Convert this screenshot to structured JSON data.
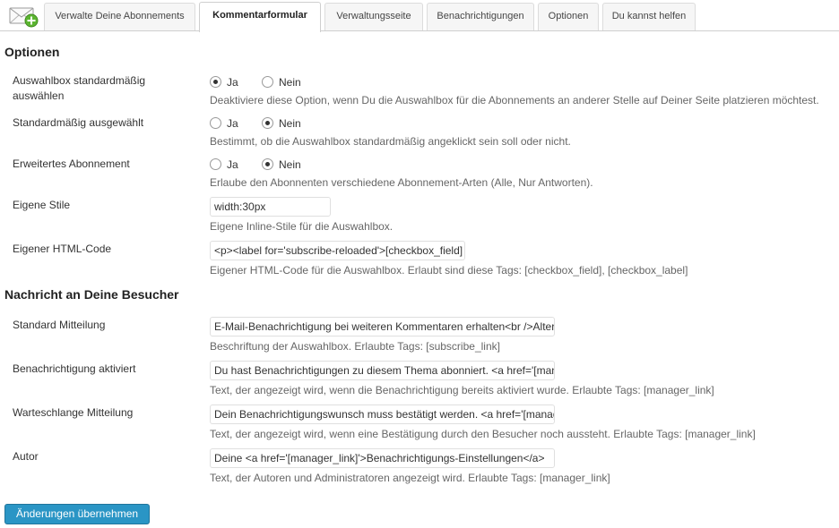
{
  "tabs": [
    {
      "label": "Verwalte Deine Abonnements",
      "active": false
    },
    {
      "label": "Kommentarformular",
      "active": true
    },
    {
      "label": "Verwaltungsseite",
      "active": false
    },
    {
      "label": "Benachrichtigungen",
      "active": false
    },
    {
      "label": "Optionen",
      "active": false
    },
    {
      "label": "Du kannst helfen",
      "active": false
    }
  ],
  "app_icon": "envelope-plus-icon",
  "section_options": {
    "title": "Optionen",
    "rows": [
      {
        "label": "Auswahlbox standardmäßig auswählen",
        "yes": "Ja",
        "no": "Nein",
        "selected": "yes",
        "desc": "Deaktiviere diese Option, wenn Du die Auswahlbox für die Abonnements an anderer Stelle auf Deiner Seite platzieren möchtest."
      },
      {
        "label": "Standardmäßig ausgewählt",
        "yes": "Ja",
        "no": "Nein",
        "selected": "no",
        "desc": "Bestimmt, ob die Auswahlbox standardmäßig angeklickt sein soll oder nicht."
      },
      {
        "label": "Erweitertes Abonnement",
        "yes": "Ja",
        "no": "Nein",
        "selected": "no",
        "desc": "Erlaube den Abonnenten verschiedene Abonnement-Arten (Alle, Nur Antworten)."
      }
    ],
    "custom_style": {
      "label": "Eigene Stile",
      "value": "width:30px",
      "desc": "Eigene Inline-Stile für die Auswahlbox."
    },
    "custom_html": {
      "label": "Eigener HTML-Code",
      "value": "<p><label for='subscribe-reloaded'>[checkbox_field]",
      "desc": "Eigener HTML-Code für die Auswahlbox. Erlaubt sind diese Tags: [checkbox_field], [checkbox_label]"
    }
  },
  "section_messages": {
    "title": "Nachricht an Deine Besucher",
    "rows": [
      {
        "label": "Standard Mitteilung",
        "value": "E-Mail-Benachrichtigung bei weiteren Kommentaren erhalten<br />Alternativ",
        "desc": "Beschriftung der Auswahlbox. Erlaubte Tags: [subscribe_link]"
      },
      {
        "label": "Benachrichtigung aktiviert",
        "value": "Du hast Benachrichtigungen zu diesem Thema abonniert. <a href='[manager_link]'>",
        "desc": "Text, der angezeigt wird, wenn die Benachrichtigung bereits aktiviert wurde. Erlaubte Tags: [manager_link]"
      },
      {
        "label": "Warteschlange Mitteilung",
        "value": "Dein Benachrichtigungswunsch muss bestätigt werden. <a href='[manager_link]'>",
        "desc": "Text, der angezeigt wird, wenn eine Bestätigung durch den Besucher noch aussteht. Erlaubte Tags: [manager_link]"
      },
      {
        "label": "Autor",
        "value": "Deine <a href='[manager_link]'>Benachrichtigungs-Einstellungen</a>",
        "desc": "Text, der Autoren und Administratoren angezeigt wird. Erlaubte Tags: [manager_link]"
      }
    ]
  },
  "submit_label": "Änderungen übernehmen",
  "colors": {
    "accent": "#2a95c5",
    "accent_border": "#21759b",
    "text": "#333333",
    "muted": "#666666"
  }
}
